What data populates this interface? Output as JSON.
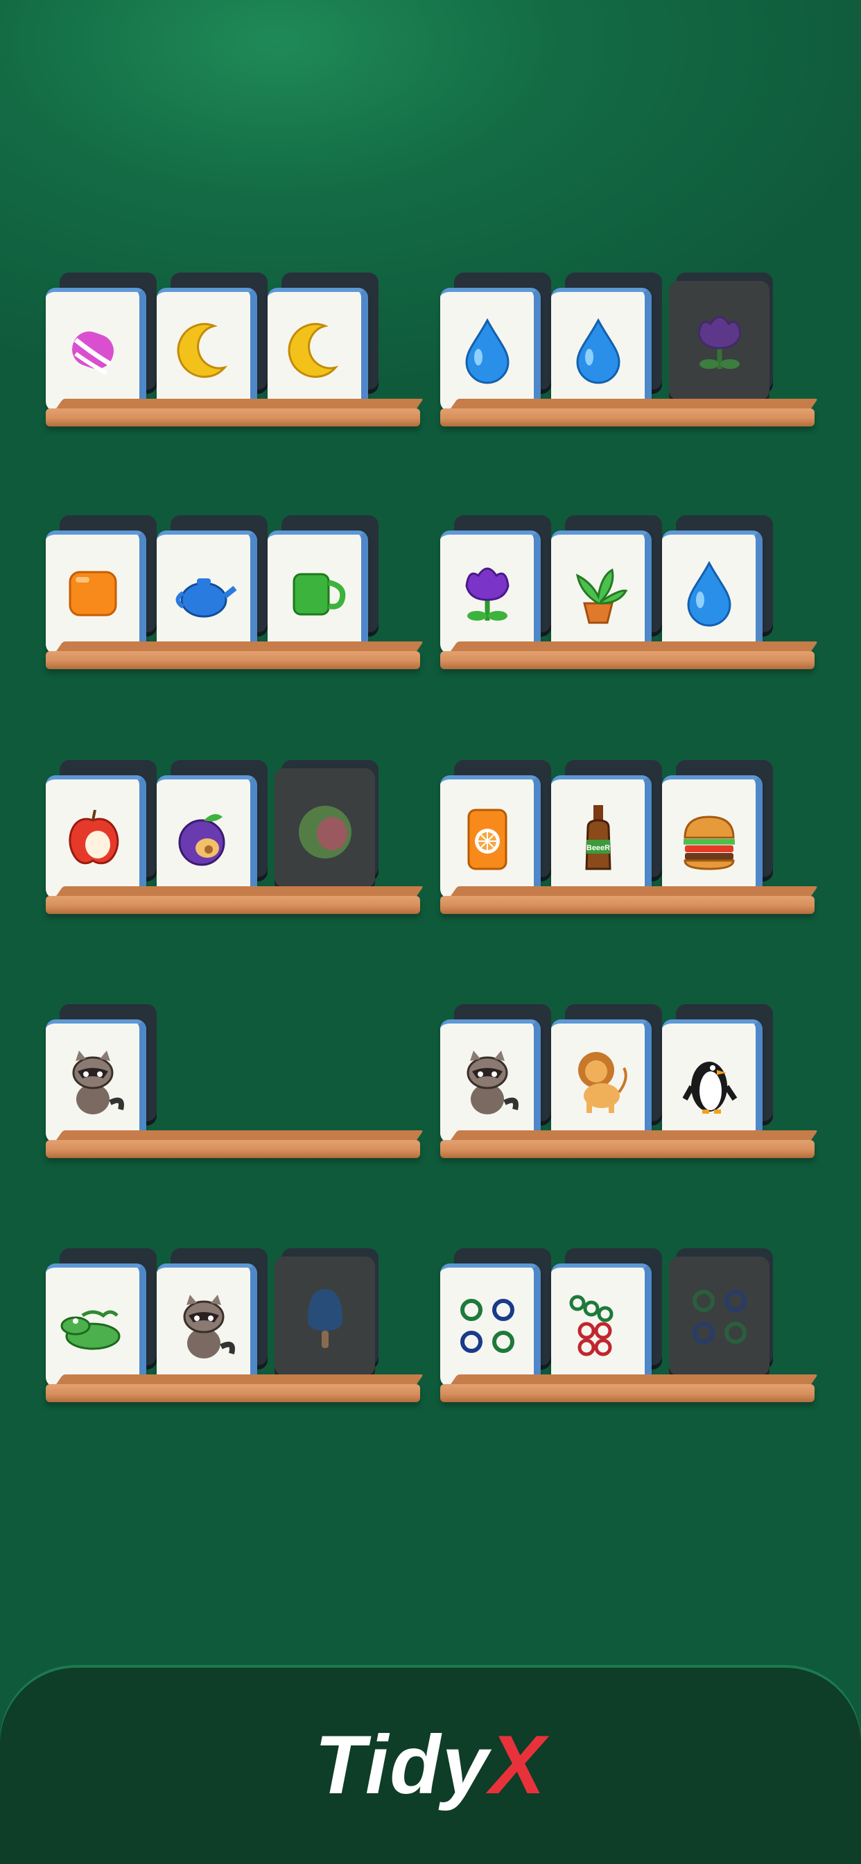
{
  "shelves": [
    {
      "tiles": [
        "candy-icon",
        "moon-icon",
        "moon-icon"
      ],
      "states": [
        "face",
        "face",
        "face"
      ]
    },
    {
      "tiles": [
        "water-drop-icon",
        "water-drop-icon",
        "flower-icon"
      ],
      "states": [
        "face",
        "face",
        "covered"
      ]
    },
    {
      "tiles": [
        "orange-jelly-icon",
        "teapot-icon",
        "mug-icon"
      ],
      "states": [
        "face",
        "face",
        "face"
      ]
    },
    {
      "tiles": [
        "flower-icon",
        "potted-plant-icon",
        "water-drop-icon"
      ],
      "states": [
        "face",
        "face",
        "face"
      ]
    },
    {
      "tiles": [
        "apple-icon",
        "plum-icon",
        "guava-icon"
      ],
      "states": [
        "face",
        "face",
        "covered"
      ]
    },
    {
      "tiles": [
        "soda-can-icon",
        "beer-bottle-icon",
        "burger-icon"
      ],
      "states": [
        "face",
        "face",
        "face"
      ]
    },
    {
      "tiles": [
        "raccoon-icon"
      ],
      "states": [
        "face"
      ]
    },
    {
      "tiles": [
        "raccoon-icon",
        "lion-icon",
        "penguin-icon"
      ],
      "states": [
        "face",
        "face",
        "face"
      ]
    },
    {
      "tiles": [
        "crocodile-icon",
        "raccoon-icon",
        "popsicle-icon"
      ],
      "states": [
        "face",
        "face",
        "covered"
      ]
    },
    {
      "tiles": [
        "circle-four-icon",
        "circle-seven-icon",
        "circle-four-icon"
      ],
      "states": [
        "face",
        "face",
        "covered"
      ]
    }
  ],
  "beer_label": "BeeeR",
  "logo": {
    "main": "Tidy",
    "accent": "X"
  },
  "colors": {
    "background": "#136b44",
    "accent": "#e8323b",
    "shelf": "#d6905c",
    "tile_edge": "#4f88c8"
  }
}
